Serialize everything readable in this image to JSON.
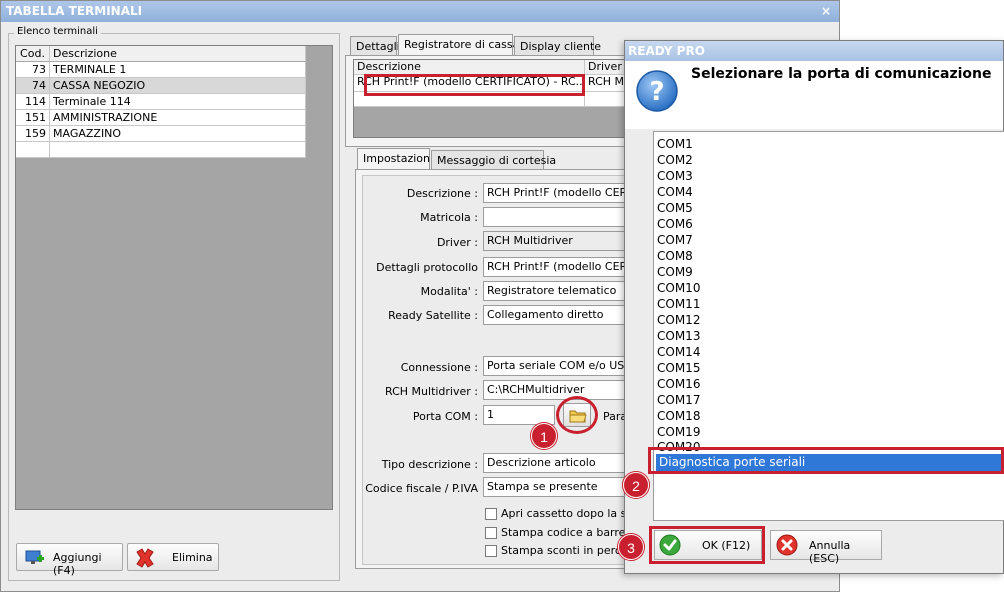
{
  "main_window": {
    "title": "TABELLA TERMINALI",
    "close_glyph": "×",
    "group_label": "Elenco terminali",
    "terminals_table": {
      "columns": [
        "Cod.",
        "Descrizione"
      ],
      "rows": [
        {
          "code": "73",
          "desc": "TERMINALE 1"
        },
        {
          "code": "74",
          "desc": "CASSA NEGOZIO"
        },
        {
          "code": "114",
          "desc": "Terminale 114"
        },
        {
          "code": "151",
          "desc": "AMMINISTRAZIONE"
        },
        {
          "code": "159",
          "desc": "MAGAZZINO"
        }
      ],
      "selected_row": 1
    },
    "buttons": {
      "add": "Aggiungi (F4)",
      "delete": "Elimina"
    },
    "tabs": [
      "Dettagli",
      "Registratore di cassa",
      "Display cliente"
    ],
    "active_tab": "Registratore di cassa",
    "register_grid": {
      "columns": [
        "Descrizione",
        "Driver"
      ],
      "row": {
        "desc": "RCH Print!F (modello CERTIFICATO) - RC...",
        "driver": "RCH Mu"
      }
    },
    "subtabs": [
      "Impostazioni",
      "Messaggio di cortesia"
    ],
    "form": {
      "descrizione_label": "Descrizione :",
      "descrizione_value": "RCH Print!F (modello CERTIF",
      "matricola_label": "Matricola :",
      "matricola_value": "",
      "driver_label": "Driver :",
      "driver_value": "RCH Multidriver",
      "protocollo_label": "Dettagli protocollo",
      "protocollo_value": "RCH Print!F (modello CERTIF",
      "modalita_label": "Modalita' :",
      "modalita_value": "Registratore telematico",
      "satellite_label": "Ready Satellite :",
      "satellite_value": "Collegamento diretto",
      "connessione_label": "Connessione :",
      "connessione_value": "Porta seriale COM e/o USB c",
      "multidriver_label": "RCH Multidriver :",
      "multidriver_value": "C:\\RCHMultidriver",
      "porta_label": "Porta COM :",
      "porta_value": "1",
      "para_label": "Para",
      "tipo_label": "Tipo descrizione :",
      "tipo_value": "Descrizione articolo",
      "codice_label": "Codice fiscale / P.IVA",
      "codice_value": "Stampa se presente",
      "checkboxes": [
        "Apri cassetto dopo la stam",
        "Stampa codice a barre ide",
        "Stampa sconti in percent"
      ]
    }
  },
  "dialog": {
    "title": "READY PRO",
    "heading": "Selezionare la porta di comunicazione",
    "ports": [
      "COM1",
      "COM2",
      "COM3",
      "COM4",
      "COM5",
      "COM6",
      "COM7",
      "COM8",
      "COM9",
      "COM10",
      "COM11",
      "COM12",
      "COM13",
      "COM14",
      "COM15",
      "COM16",
      "COM17",
      "COM18",
      "COM19",
      "COM20"
    ],
    "selected_item": "Diagnostica porte seriali",
    "ok_label": "OK (F12)",
    "cancel_label": "Annulla (ESC)"
  },
  "annotations": {
    "step1": "1",
    "step2": "2",
    "step3": "3"
  },
  "colors": {
    "highlight_red": "#c8202e",
    "selection_blue": "#3078d8",
    "title_blue": "#8fb0db"
  }
}
